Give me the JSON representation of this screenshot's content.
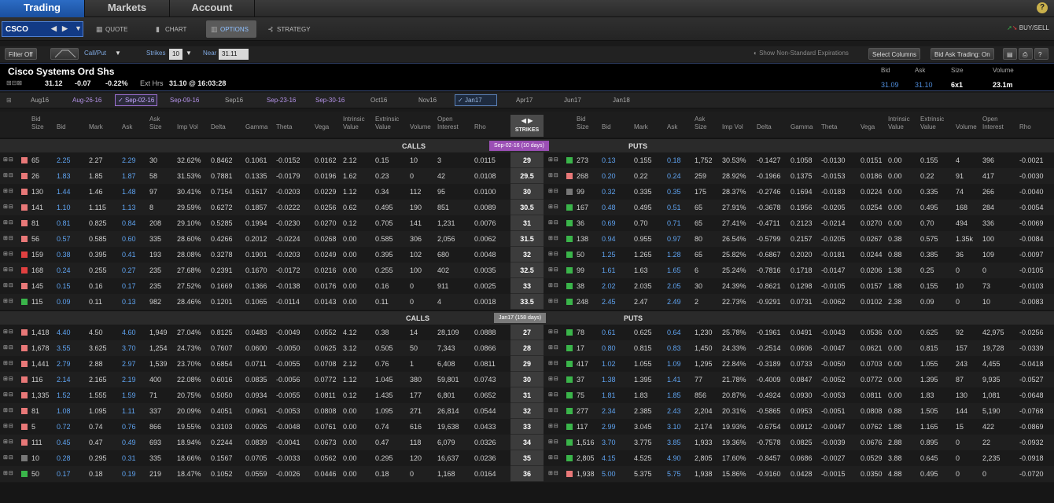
{
  "nav": {
    "tabs": [
      "Trading",
      "Markets",
      "Account"
    ],
    "help": "?"
  },
  "symbol_bar": {
    "symbol": "CSCO",
    "tabs": [
      {
        "icon": "xyz",
        "label": "QUOTE"
      },
      {
        "icon": "bars",
        "label": "CHART"
      },
      {
        "icon": "options",
        "label": "OPTIONS"
      },
      {
        "icon": "strategy",
        "label": "STRATEGY"
      }
    ],
    "buysell": "BUY/SELL"
  },
  "toolbar": {
    "filter": "Filter Off",
    "callput": "Call/Put",
    "strikes_label": "Strikes",
    "strikes_value": "10",
    "near_label": "Near",
    "near_value": "31.11",
    "nonstd": "Show Non-Standard Expirations",
    "select_columns": "Select Columns",
    "bid_ask": "Bid Ask Trading: On"
  },
  "quote": {
    "name": "Cisco Systems Ord Shs",
    "last": "31.12",
    "change": "-0.07",
    "pct": "-0.22%",
    "ext_label": "Ext Hrs",
    "ext_value": "31.10 @ 16:03:28",
    "bid_label": "Bid",
    "bid": "31.09",
    "ask_label": "Ask",
    "ask": "31.10",
    "size_label": "Size",
    "size": "6x1",
    "vol_label": "Volume",
    "volume": "23.1m"
  },
  "expirations": [
    "Aug16",
    "Aug-26-16",
    "Sep-02-16",
    "Sep-09-16",
    "Sep16",
    "Sep-23-16",
    "Sep-30-16",
    "Oct16",
    "Nov16",
    "Jan17",
    "Apr17",
    "Jun17",
    "Jan18"
  ],
  "columns": {
    "call": [
      [
        "Bid",
        "Size"
      ],
      [
        "Bid"
      ],
      [
        "Mark"
      ],
      [
        "Ask"
      ],
      [
        "Ask",
        "Size"
      ],
      [
        "Imp Vol"
      ],
      [
        "Delta"
      ],
      [
        "Gamma"
      ],
      [
        "Theta"
      ],
      [
        "Vega"
      ],
      [
        "Intrinsic",
        "Value"
      ],
      [
        "Extrinsic",
        "Value"
      ],
      [
        "Volume"
      ],
      [
        "Open",
        "Interest"
      ],
      [
        "Rho"
      ]
    ],
    "strikes": "STRIKES",
    "put": [
      [
        "Bid",
        "Size"
      ],
      [
        "Bid"
      ],
      [
        "Mark"
      ],
      [
        "Ask"
      ],
      [
        "Ask",
        "Size"
      ],
      [
        "Imp Vol"
      ],
      [
        "Delta"
      ],
      [
        "Gamma"
      ],
      [
        "Theta"
      ],
      [
        "Vega"
      ],
      [
        "Intrinsic",
        "Value"
      ],
      [
        "Extrinsic",
        "Value"
      ],
      [
        "Volume"
      ],
      [
        "Open",
        "Interest"
      ],
      [
        "Rho"
      ]
    ]
  },
  "sections": [
    {
      "calls_label": "CALLS",
      "puts_label": "PUTS",
      "expiry": "Sep-02-16   (10 days)",
      "badge_color": "#9b4fb5",
      "rows": [
        {
          "c": [
            "65",
            "2.25",
            "2.27",
            "2.29",
            "30",
            "32.62%",
            "0.8462",
            "0.1061",
            "-0.0152",
            "0.0162",
            "2.12",
            "0.15",
            "10",
            "3",
            "0.0115"
          ],
          "cc": "#e87878",
          "strike": "29",
          "pc": "#3ab54a",
          "p": [
            "273",
            "0.13",
            "0.155",
            "0.18",
            "1,752",
            "30.53%",
            "-0.1427",
            "0.1058",
            "-0.0130",
            "0.0151",
            "0.00",
            "0.155",
            "4",
            "396",
            "-0.0021"
          ]
        },
        {
          "c": [
            "26",
            "1.83",
            "1.85",
            "1.87",
            "58",
            "31.53%",
            "0.7881",
            "0.1335",
            "-0.0179",
            "0.0196",
            "1.62",
            "0.23",
            "0",
            "42",
            "0.0108"
          ],
          "cc": "#e87878",
          "strike": "29.5",
          "pc": "#e87878",
          "p": [
            "268",
            "0.20",
            "0.22",
            "0.24",
            "259",
            "28.92%",
            "-0.1966",
            "0.1375",
            "-0.0153",
            "0.0186",
            "0.00",
            "0.22",
            "91",
            "417",
            "-0.0030"
          ]
        },
        {
          "c": [
            "130",
            "1.44",
            "1.46",
            "1.48",
            "97",
            "30.41%",
            "0.7154",
            "0.1617",
            "-0.0203",
            "0.0229",
            "1.12",
            "0.34",
            "112",
            "95",
            "0.0100"
          ],
          "cc": "#e87878",
          "strike": "30",
          "pc": "#777777",
          "p": [
            "99",
            "0.32",
            "0.335",
            "0.35",
            "175",
            "28.37%",
            "-0.2746",
            "0.1694",
            "-0.0183",
            "0.0224",
            "0.00",
            "0.335",
            "74",
            "266",
            "-0.0040"
          ]
        },
        {
          "c": [
            "141",
            "1.10",
            "1.115",
            "1.13",
            "8",
            "29.59%",
            "0.6272",
            "0.1857",
            "-0.0222",
            "0.0256",
            "0.62",
            "0.495",
            "190",
            "851",
            "0.0089"
          ],
          "cc": "#e87878",
          "strike": "30.5",
          "pc": "#3ab54a",
          "p": [
            "167",
            "0.48",
            "0.495",
            "0.51",
            "65",
            "27.91%",
            "-0.3678",
            "0.1956",
            "-0.0205",
            "0.0254",
            "0.00",
            "0.495",
            "168",
            "284",
            "-0.0054"
          ]
        },
        {
          "c": [
            "81",
            "0.81",
            "0.825",
            "0.84",
            "208",
            "29.10%",
            "0.5285",
            "0.1994",
            "-0.0230",
            "0.0270",
            "0.12",
            "0.705",
            "141",
            "1,231",
            "0.0076"
          ],
          "cc": "#e87878",
          "strike": "31",
          "pc": "#3ab54a",
          "p": [
            "36",
            "0.69",
            "0.70",
            "0.71",
            "65",
            "27.41%",
            "-0.4711",
            "0.2123",
            "-0.0214",
            "0.0270",
            "0.00",
            "0.70",
            "494",
            "336",
            "-0.0069"
          ]
        },
        {
          "c": [
            "56",
            "0.57",
            "0.585",
            "0.60",
            "335",
            "28.60%",
            "0.4266",
            "0.2012",
            "-0.0224",
            "0.0268",
            "0.00",
            "0.585",
            "306",
            "2,056",
            "0.0062"
          ],
          "cc": "#e87878",
          "strike": "31.5",
          "pc": "#3ab54a",
          "p": [
            "138",
            "0.94",
            "0.955",
            "0.97",
            "80",
            "26.54%",
            "-0.5799",
            "0.2157",
            "-0.0205",
            "0.0267",
            "0.38",
            "0.575",
            "1.35k",
            "100",
            "-0.0084"
          ]
        },
        {
          "c": [
            "159",
            "0.38",
            "0.395",
            "0.41",
            "193",
            "28.08%",
            "0.3278",
            "0.1901",
            "-0.0203",
            "0.0249",
            "0.00",
            "0.395",
            "102",
            "680",
            "0.0048"
          ],
          "cc": "#e04040",
          "strike": "32",
          "pc": "#3ab54a",
          "p": [
            "50",
            "1.25",
            "1.265",
            "1.28",
            "65",
            "25.82%",
            "-0.6867",
            "0.2020",
            "-0.0181",
            "0.0244",
            "0.88",
            "0.385",
            "36",
            "109",
            "-0.0097"
          ]
        },
        {
          "c": [
            "168",
            "0.24",
            "0.255",
            "0.27",
            "235",
            "27.68%",
            "0.2391",
            "0.1670",
            "-0.0172",
            "0.0216",
            "0.00",
            "0.255",
            "100",
            "402",
            "0.0035"
          ],
          "cc": "#e04040",
          "strike": "32.5",
          "pc": "#3ab54a",
          "p": [
            "99",
            "1.61",
            "1.63",
            "1.65",
            "6",
            "25.24%",
            "-0.7816",
            "0.1718",
            "-0.0147",
            "0.0206",
            "1.38",
            "0.25",
            "0",
            "0",
            "-0.0105"
          ]
        },
        {
          "c": [
            "145",
            "0.15",
            "0.16",
            "0.17",
            "235",
            "27.52%",
            "0.1669",
            "0.1366",
            "-0.0138",
            "0.0176",
            "0.00",
            "0.16",
            "0",
            "911",
            "0.0025"
          ],
          "cc": "#e87878",
          "strike": "33",
          "pc": "#3ab54a",
          "p": [
            "38",
            "2.02",
            "2.035",
            "2.05",
            "30",
            "24.39%",
            "-0.8621",
            "0.1298",
            "-0.0105",
            "0.0157",
            "1.88",
            "0.155",
            "10",
            "73",
            "-0.0103"
          ]
        },
        {
          "c": [
            "115",
            "0.09",
            "0.11",
            "0.13",
            "982",
            "28.46%",
            "0.1201",
            "0.1065",
            "-0.0114",
            "0.0143",
            "0.00",
            "0.11",
            "0",
            "4",
            "0.0018"
          ],
          "cc": "#3ab54a",
          "strike": "33.5",
          "pc": "#3ab54a",
          "p": [
            "248",
            "2.45",
            "2.47",
            "2.49",
            "2",
            "22.73%",
            "-0.9291",
            "0.0731",
            "-0.0062",
            "0.0102",
            "2.38",
            "0.09",
            "0",
            "10",
            "-0.0083"
          ]
        }
      ]
    },
    {
      "calls_label": "CALLS",
      "puts_label": "PUTS",
      "expiry": "Jan17   (158 days)",
      "badge_color": "#7a7a7a",
      "rows": [
        {
          "c": [
            "1,418",
            "4.40",
            "4.50",
            "4.60",
            "1,949",
            "27.04%",
            "0.8125",
            "0.0483",
            "-0.0049",
            "0.0552",
            "4.12",
            "0.38",
            "14",
            "28,109",
            "0.0888"
          ],
          "cc": "#e87878",
          "strike": "27",
          "pc": "#3ab54a",
          "p": [
            "78",
            "0.61",
            "0.625",
            "0.64",
            "1,230",
            "25.78%",
            "-0.1961",
            "0.0491",
            "-0.0043",
            "0.0536",
            "0.00",
            "0.625",
            "92",
            "42,975",
            "-0.0256"
          ]
        },
        {
          "c": [
            "1,678",
            "3.55",
            "3.625",
            "3.70",
            "1,254",
            "24.73%",
            "0.7607",
            "0.0600",
            "-0.0050",
            "0.0625",
            "3.12",
            "0.505",
            "50",
            "7,343",
            "0.0866"
          ],
          "cc": "#e87878",
          "strike": "28",
          "pc": "#3ab54a",
          "p": [
            "17",
            "0.80",
            "0.815",
            "0.83",
            "1,450",
            "24.33%",
            "-0.2514",
            "0.0606",
            "-0.0047",
            "0.0621",
            "0.00",
            "0.815",
            "157",
            "19,728",
            "-0.0339"
          ]
        },
        {
          "c": [
            "1,441",
            "2.79",
            "2.88",
            "2.97",
            "1,539",
            "23.70%",
            "0.6854",
            "0.0711",
            "-0.0055",
            "0.0708",
            "2.12",
            "0.76",
            "1",
            "6,408",
            "0.0811"
          ],
          "cc": "#e87878",
          "strike": "29",
          "pc": "#3ab54a",
          "p": [
            "417",
            "1.02",
            "1.055",
            "1.09",
            "1,295",
            "22.84%",
            "-0.3189",
            "0.0733",
            "-0.0050",
            "0.0703",
            "0.00",
            "1.055",
            "243",
            "4,455",
            "-0.0418"
          ]
        },
        {
          "c": [
            "116",
            "2.14",
            "2.165",
            "2.19",
            "400",
            "22.08%",
            "0.6016",
            "0.0835",
            "-0.0056",
            "0.0772",
            "1.12",
            "1.045",
            "380",
            "59,801",
            "0.0743"
          ],
          "cc": "#e87878",
          "strike": "30",
          "pc": "#3ab54a",
          "p": [
            "37",
            "1.38",
            "1.395",
            "1.41",
            "77",
            "21.78%",
            "-0.4009",
            "0.0847",
            "-0.0052",
            "0.0772",
            "0.00",
            "1.395",
            "87",
            "9,935",
            "-0.0527"
          ]
        },
        {
          "c": [
            "1,335",
            "1.52",
            "1.555",
            "1.59",
            "71",
            "20.75%",
            "0.5050",
            "0.0934",
            "-0.0055",
            "0.0811",
            "0.12",
            "1.435",
            "177",
            "6,801",
            "0.0652"
          ],
          "cc": "#e87878",
          "strike": "31",
          "pc": "#3ab54a",
          "p": [
            "75",
            "1.81",
            "1.83",
            "1.85",
            "856",
            "20.87%",
            "-0.4924",
            "0.0930",
            "-0.0053",
            "0.0811",
            "0.00",
            "1.83",
            "130",
            "1,081",
            "-0.0648"
          ]
        },
        {
          "c": [
            "81",
            "1.08",
            "1.095",
            "1.11",
            "337",
            "20.09%",
            "0.4051",
            "0.0961",
            "-0.0053",
            "0.0808",
            "0.00",
            "1.095",
            "271",
            "26,814",
            "0.0544"
          ],
          "cc": "#e87878",
          "strike": "32",
          "pc": "#3ab54a",
          "p": [
            "277",
            "2.34",
            "2.385",
            "2.43",
            "2,204",
            "20.31%",
            "-0.5865",
            "0.0953",
            "-0.0051",
            "0.0808",
            "0.88",
            "1.505",
            "144",
            "5,190",
            "-0.0768"
          ]
        },
        {
          "c": [
            "5",
            "0.72",
            "0.74",
            "0.76",
            "866",
            "19.55%",
            "0.3103",
            "0.0926",
            "-0.0048",
            "0.0761",
            "0.00",
            "0.74",
            "616",
            "19,638",
            "0.0433"
          ],
          "cc": "#e87878",
          "strike": "33",
          "pc": "#3ab54a",
          "p": [
            "117",
            "2.99",
            "3.045",
            "3.10",
            "2,174",
            "19.93%",
            "-0.6754",
            "0.0912",
            "-0.0047",
            "0.0762",
            "1.88",
            "1.165",
            "15",
            "422",
            "-0.0869"
          ]
        },
        {
          "c": [
            "111",
            "0.45",
            "0.47",
            "0.49",
            "693",
            "18.94%",
            "0.2244",
            "0.0839",
            "-0.0041",
            "0.0673",
            "0.00",
            "0.47",
            "118",
            "6,079",
            "0.0326"
          ],
          "cc": "#e87878",
          "strike": "34",
          "pc": "#3ab54a",
          "p": [
            "1,516",
            "3.70",
            "3.775",
            "3.85",
            "1,933",
            "19.36%",
            "-0.7578",
            "0.0825",
            "-0.0039",
            "0.0676",
            "2.88",
            "0.895",
            "0",
            "22",
            "-0.0932"
          ]
        },
        {
          "c": [
            "10",
            "0.28",
            "0.295",
            "0.31",
            "335",
            "18.66%",
            "0.1567",
            "0.0705",
            "-0.0033",
            "0.0562",
            "0.00",
            "0.295",
            "120",
            "16,637",
            "0.0236"
          ],
          "cc": "#777777",
          "strike": "35",
          "pc": "#3ab54a",
          "p": [
            "2,805",
            "4.15",
            "4.525",
            "4.90",
            "2,805",
            "17.60%",
            "-0.8457",
            "0.0686",
            "-0.0027",
            "0.0529",
            "3.88",
            "0.645",
            "0",
            "2,235",
            "-0.0918"
          ]
        },
        {
          "c": [
            "50",
            "0.17",
            "0.18",
            "0.19",
            "219",
            "18.47%",
            "0.1052",
            "0.0559",
            "-0.0026",
            "0.0446",
            "0.00",
            "0.18",
            "0",
            "1,168",
            "0.0164"
          ],
          "cc": "#3ab54a",
          "strike": "36",
          "pc": "#e87878",
          "p": [
            "1,938",
            "5.00",
            "5.375",
            "5.75",
            "1,938",
            "15.86%",
            "-0.9160",
            "0.0428",
            "-0.0015",
            "0.0350",
            "4.88",
            "0.495",
            "0",
            "0",
            "-0.0720"
          ]
        }
      ]
    }
  ]
}
